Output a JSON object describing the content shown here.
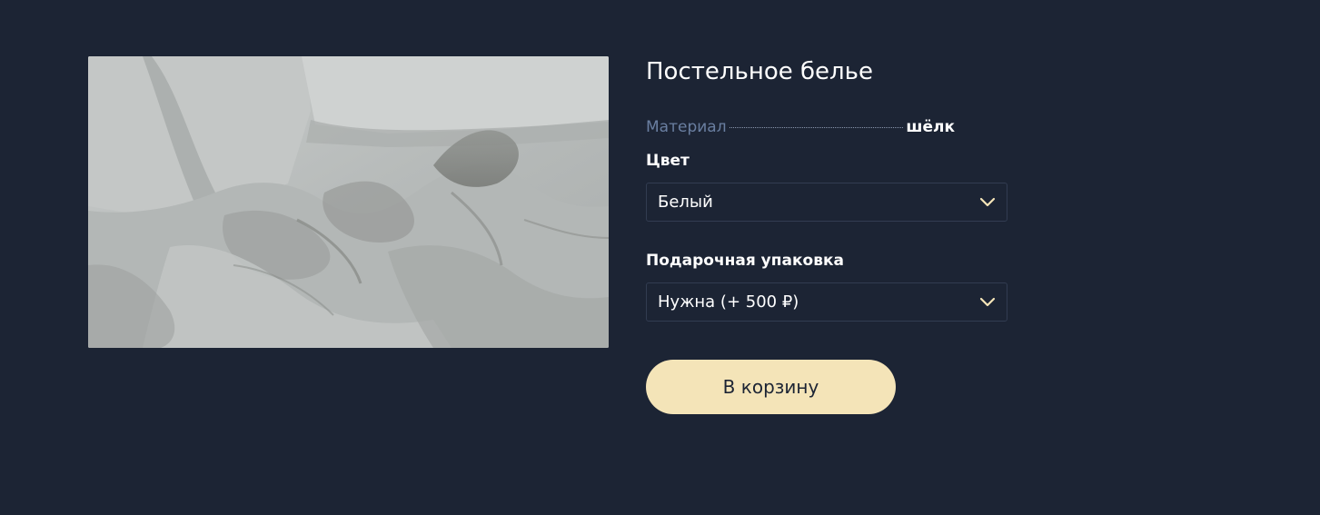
{
  "product": {
    "title": "Постельное белье",
    "image_alt": "bed-linen-photo"
  },
  "specs": {
    "material_label": "Материал",
    "material_value": "шёлк"
  },
  "color_field": {
    "label": "Цвет",
    "selected": "Белый"
  },
  "gift_field": {
    "label": "Подарочная упаковка",
    "selected": "Нужна (+ 500 ₽)"
  },
  "actions": {
    "add_to_cart_label": "В корзину"
  },
  "theme": {
    "background": "#1c2434",
    "accent_button": "#f4e4b8",
    "muted_label": "#6a7fa1",
    "chevron": "#f4e4b8"
  },
  "icons": {
    "select_chevron": "chevron-down-icon"
  }
}
